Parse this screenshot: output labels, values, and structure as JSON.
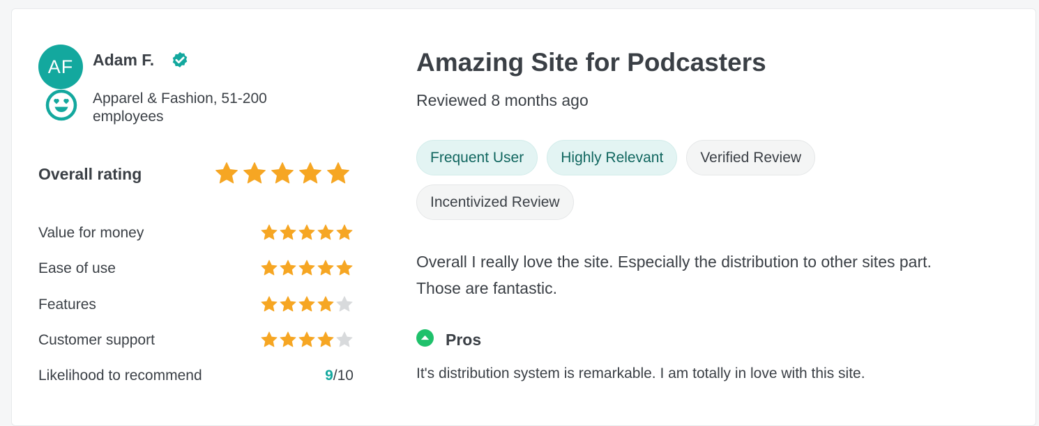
{
  "reviewer": {
    "initials": "AF",
    "name": "Adam F.",
    "company_info": "Apparel & Fashion, 51-200 employees",
    "avatar_color": "#13a89e",
    "verified_icon": "verified-badge-icon",
    "sentiment_icon": "smiling-face-heart-eyes-icon"
  },
  "ratings": {
    "overall_label": "Overall rating",
    "overall_stars": 5,
    "items": [
      {
        "label": "Value for money",
        "stars": 5
      },
      {
        "label": "Ease of use",
        "stars": 5
      },
      {
        "label": "Features",
        "stars": 4
      },
      {
        "label": "Customer support",
        "stars": 4
      }
    ],
    "recommend": {
      "label": "Likelihood to recommend",
      "score": "9",
      "max": "/10"
    },
    "star_color": "#f6a623",
    "empty_star_color": "#d8dadc"
  },
  "review": {
    "title": "Amazing Site for Podcasters",
    "date": "Reviewed 8 months ago",
    "tags": [
      {
        "label": "Frequent User",
        "style": "teal"
      },
      {
        "label": "Highly Relevant",
        "style": "teal"
      },
      {
        "label": "Verified Review",
        "style": "grey"
      },
      {
        "label": "Incentivized Review",
        "style": "grey"
      }
    ],
    "body": "Overall I really love the site. Especially the distribution to other sites part. Those are fantastic.",
    "pros_heading": "Pros",
    "pros_icon": "chevron-up-circle-icon",
    "pros_text": "It's distribution system is remarkable. I am totally in love with this site."
  }
}
